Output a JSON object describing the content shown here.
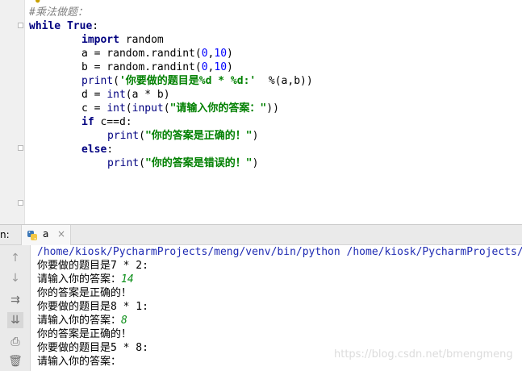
{
  "editor": {
    "lines": [
      {
        "segments": [
          {
            "t": "#乘法做题：",
            "c": "cmt"
          }
        ]
      },
      {
        "segments": [
          {
            "t": "while ",
            "c": "kw"
          },
          {
            "t": "True",
            "c": "kw"
          },
          {
            "t": ":",
            "c": ""
          }
        ]
      },
      {
        "segments": [
          {
            "t": "import ",
            "c": "kw"
          },
          {
            "t": "random",
            "c": ""
          }
        ]
      },
      {
        "segments": [
          {
            "t": "a = random.randint(",
            "c": ""
          },
          {
            "t": "0",
            "c": "num"
          },
          {
            "t": ",",
            "c": ""
          },
          {
            "t": "10",
            "c": "num"
          },
          {
            "t": ")",
            "c": ""
          }
        ]
      },
      {
        "segments": [
          {
            "t": "b = random.randint(",
            "c": ""
          },
          {
            "t": "0",
            "c": "num"
          },
          {
            "t": ",",
            "c": ""
          },
          {
            "t": "10",
            "c": "num"
          },
          {
            "t": ")",
            "c": ""
          }
        ]
      },
      {
        "segments": [
          {
            "t": "print",
            "c": "fn"
          },
          {
            "t": "(",
            "c": ""
          },
          {
            "t": "'你要做的题目是%d * %d:'",
            "c": "str"
          },
          {
            "t": "  %(a,b))",
            "c": ""
          }
        ]
      },
      {
        "segments": [
          {
            "t": "d = ",
            "c": ""
          },
          {
            "t": "int",
            "c": "fn"
          },
          {
            "t": "(a * b)",
            "c": ""
          }
        ]
      },
      {
        "segments": [
          {
            "t": "c = ",
            "c": ""
          },
          {
            "t": "int",
            "c": "fn"
          },
          {
            "t": "(",
            "c": ""
          },
          {
            "t": "input",
            "c": "fn"
          },
          {
            "t": "(",
            "c": ""
          },
          {
            "t": "\"请输入你的答案：\"",
            "c": "str"
          },
          {
            "t": "))",
            "c": ""
          }
        ]
      },
      {
        "segments": [
          {
            "t": "if ",
            "c": "kw"
          },
          {
            "t": "c==d:",
            "c": ""
          }
        ]
      },
      {
        "segments": [
          {
            "t": "print",
            "c": "fn"
          },
          {
            "t": "(",
            "c": ""
          },
          {
            "t": "\"你的答案是正确的！\"",
            "c": "str"
          },
          {
            "t": ")",
            "c": ""
          }
        ]
      },
      {
        "segments": [
          {
            "t": "else",
            "c": "kw"
          },
          {
            "t": ":",
            "c": ""
          }
        ]
      },
      {
        "segments": [
          {
            "t": "print",
            "c": "fn"
          },
          {
            "t": "(",
            "c": ""
          },
          {
            "t": "\"你的答案是错误的！\"",
            "c": "str"
          },
          {
            "t": ")",
            "c": ""
          }
        ]
      }
    ]
  },
  "run_panel": {
    "label": "n:",
    "tab_name": "a",
    "tab_close": "×"
  },
  "console": {
    "lines": [
      {
        "text": "/home/kiosk/PycharmProjects/meng/venv/bin/python /home/kiosk/PycharmProjects/meng/a.py",
        "kind": "cmd"
      },
      {
        "text": "你要做的题目是7 * 2:",
        "kind": "out"
      },
      {
        "text": "请输入你的答案：",
        "input": "14",
        "kind": "out"
      },
      {
        "text": "你的答案是正确的！",
        "kind": "out"
      },
      {
        "text": "你要做的题目是8 * 1:",
        "kind": "out"
      },
      {
        "text": "请输入你的答案：",
        "input": "8",
        "kind": "out"
      },
      {
        "text": "你的答案是正确的！",
        "kind": "out"
      },
      {
        "text": "你要做的题目是5 * 8:",
        "kind": "out"
      },
      {
        "text": "请输入你的答案：",
        "kind": "out"
      }
    ]
  },
  "watermark": "https://blog.csdn.net/bmengmeng"
}
